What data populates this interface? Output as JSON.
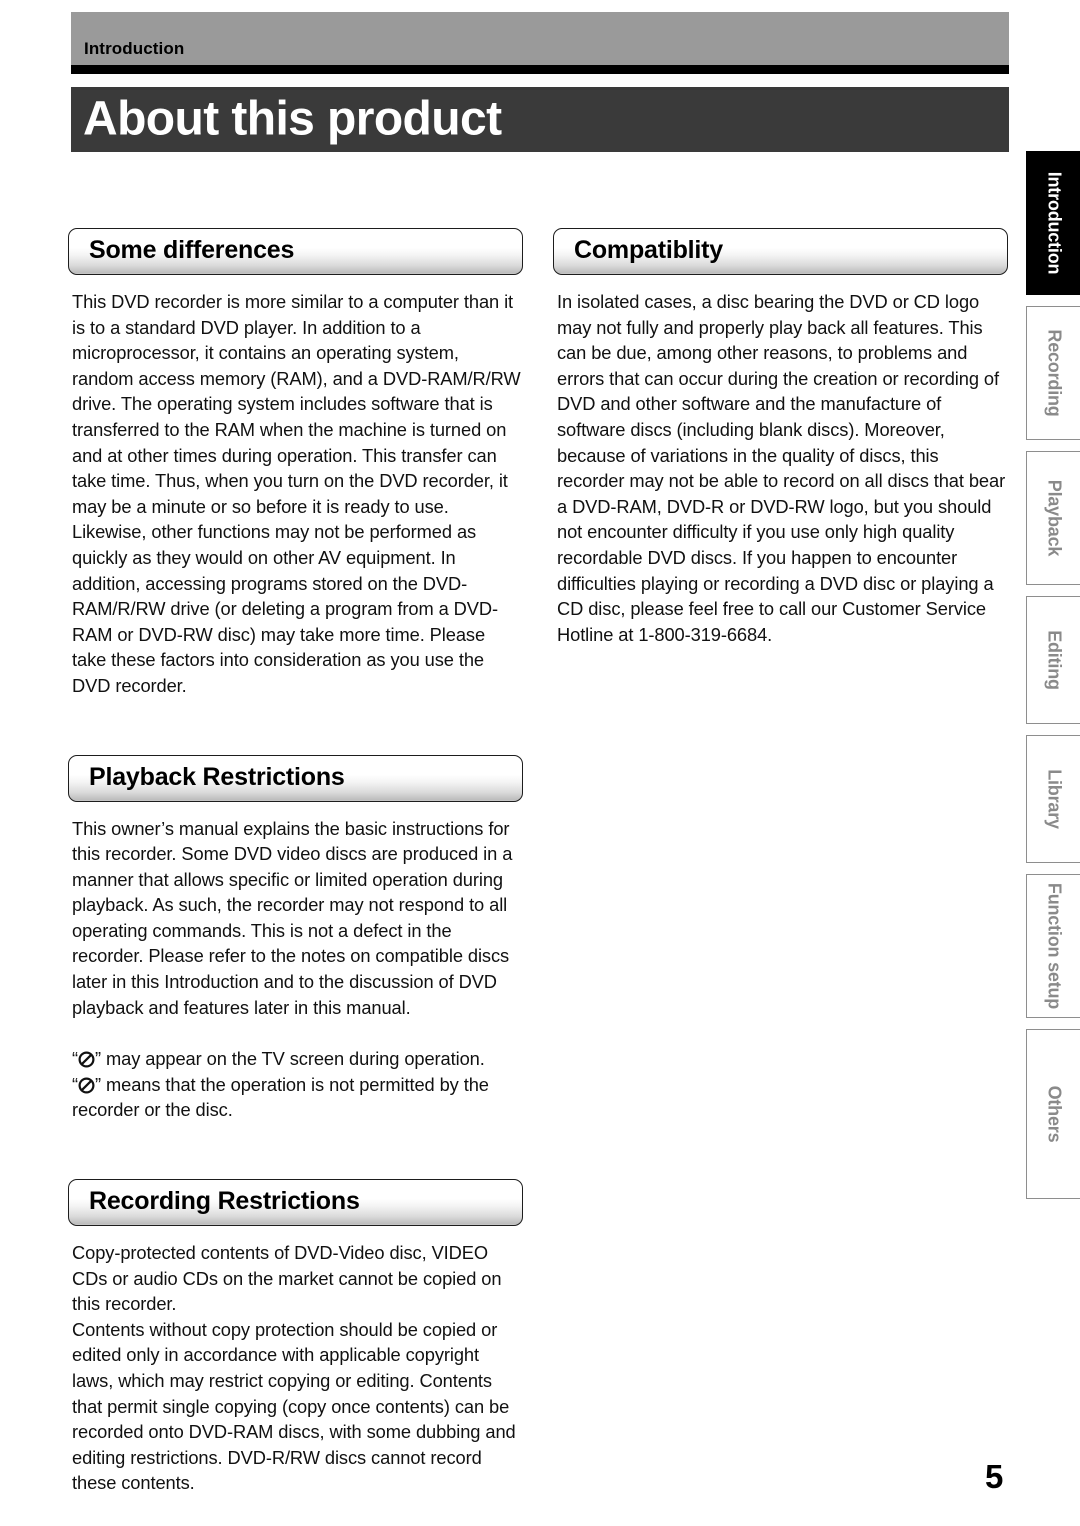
{
  "header": {
    "section_label": "Introduction",
    "page_title": "About this product"
  },
  "left_column": {
    "sections": [
      {
        "heading": "Some differences",
        "paragraphs": [
          "This DVD recorder is more similar to a computer than it is to a standard DVD player.  In addition to a microprocessor, it contains an operating system, random access memory (RAM), and a DVD-RAM/R/RW drive.  The operating system includes software that is transferred to the RAM when the machine is turned on and at other times during operation.  This transfer can take time.  Thus, when you turn on the DVD recorder, it may be a minute or so before it is ready to use.  Likewise, other functions may not be performed as quickly as they would on other AV equipment.  In addition, accessing programs stored on the DVD-RAM/R/RW drive (or deleting a program from a DVD-RAM or DVD-RW disc) may take more time.  Please take these factors into consideration as you use the DVD recorder."
        ]
      },
      {
        "heading": "Playback Restrictions",
        "paragraphs": [
          "This owner’s manual explains the basic instructions for this recorder. Some DVD video discs are produced in a manner that allows specific or limited operation during playback. As such, the recorder may not respond to all operating commands. This is not a defect in the recorder. Please refer to the notes on compatible discs later in this Introduction and to the discussion of DVD playback and features later in this manual."
        ],
        "note": {
          "line1_before": "“",
          "line1_after": "” may appear on the TV screen during operation.",
          "line2_before": "“",
          "line2_after": "” means that the operation is not permitted by the recorder or the disc.",
          "symbol_name": "prohibition-sign"
        }
      },
      {
        "heading": "Recording Restrictions",
        "paragraphs": [
          "Copy-protected contents of DVD-Video disc, VIDEO CDs or audio CDs on the market cannot be copied on this recorder.",
          "Contents without copy protection should be copied or edited only in accordance with applicable copyright laws, which may restrict copying or editing. Contents that permit single copying (copy once contents) can be recorded onto DVD-RAM discs, with some dubbing and editing restrictions. DVD-R/RW discs cannot record these contents."
        ]
      }
    ]
  },
  "right_column": {
    "sections": [
      {
        "heading": "Compatiblity",
        "paragraphs": [
          "In isolated cases, a disc bearing the DVD or CD logo may not fully and properly play back all features.  This can be due, among other reasons, to problems and errors that can occur during the creation or recording of DVD and other software and the manufacture of software discs (including blank discs).  Moreover, because of variations in the quality of discs, this recorder may not be able to record on all discs that bear a DVD-RAM, DVD-R or DVD-RW logo, but you should not encounter difficulty if you use only high quality recordable DVD discs. If you happen to encounter difficulties playing or recording a DVD disc or playing a CD disc, please feel free to call our Customer Service Hotline at 1-800-319-6684."
        ]
      }
    ]
  },
  "tab_strip": {
    "tabs": [
      {
        "label": "Introduction",
        "active": true
      },
      {
        "label": "Recording",
        "active": false
      },
      {
        "label": "Playback",
        "active": false
      },
      {
        "label": "Editing",
        "active": false
      },
      {
        "label": "Library",
        "active": false
      },
      {
        "label": "Function setup",
        "active": false
      },
      {
        "label": "Others",
        "active": false
      }
    ]
  },
  "footer": {
    "page_number": "5"
  },
  "colors": {
    "header_band": "#9a9a9a",
    "title_band": "#3a3a3a",
    "active_tab": "#000000",
    "inactive_tab_text": "#8a8a8a"
  }
}
